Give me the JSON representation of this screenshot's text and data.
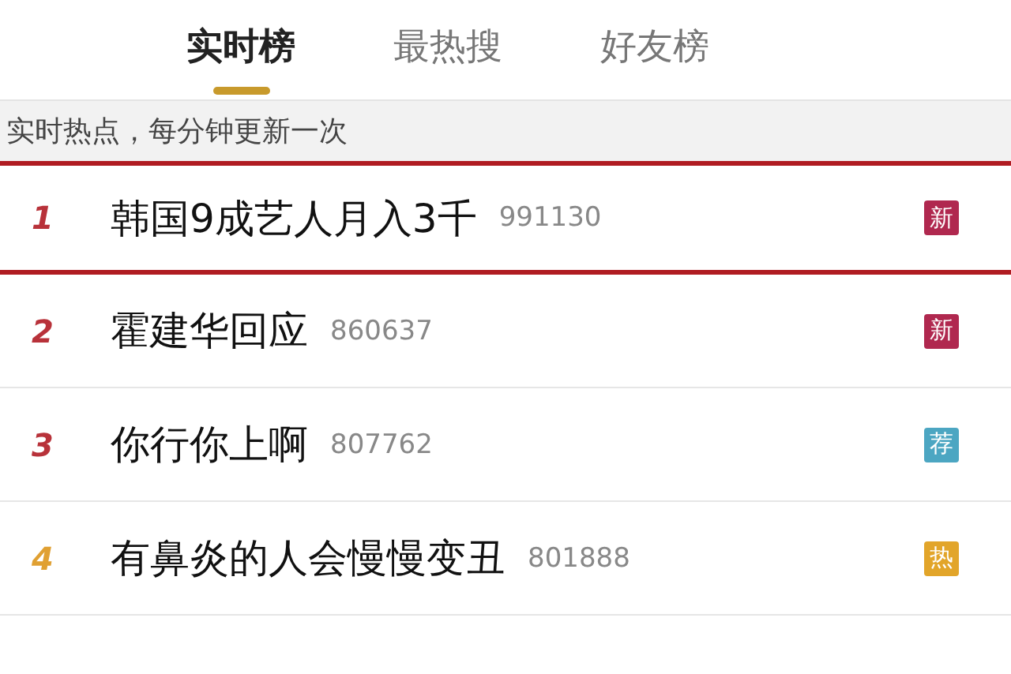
{
  "tabs": [
    {
      "label": "实时榜",
      "selected": true
    },
    {
      "label": "最热搜",
      "selected": false
    },
    {
      "label": "好友榜",
      "selected": false
    }
  ],
  "notice": "实时热点，每分钟更新一次",
  "rows": [
    {
      "rank": {
        "text": "1",
        "color": "#b8323a"
      },
      "title": "韩国9成艺人月入3千",
      "count": "991130",
      "badge": {
        "text": "新",
        "color": "#b0284f"
      },
      "highlighted": true
    },
    {
      "rank": {
        "text": "2",
        "color": "#b8323a"
      },
      "title": "霍建华回应",
      "count": "860637",
      "badge": {
        "text": "新",
        "color": "#b0284f"
      },
      "highlighted": false
    },
    {
      "rank": {
        "text": "3",
        "color": "#b8323a"
      },
      "title": "你行你上啊",
      "count": "807762",
      "badge": {
        "text": "荐",
        "color": "#4ca6c2"
      },
      "highlighted": false
    },
    {
      "rank": {
        "text": "4",
        "color": "#e0a032"
      },
      "title": "有鼻炎的人会慢慢变丑",
      "count": "801888",
      "badge": {
        "text": "热",
        "color": "#e2a52a"
      },
      "highlighted": false
    }
  ]
}
